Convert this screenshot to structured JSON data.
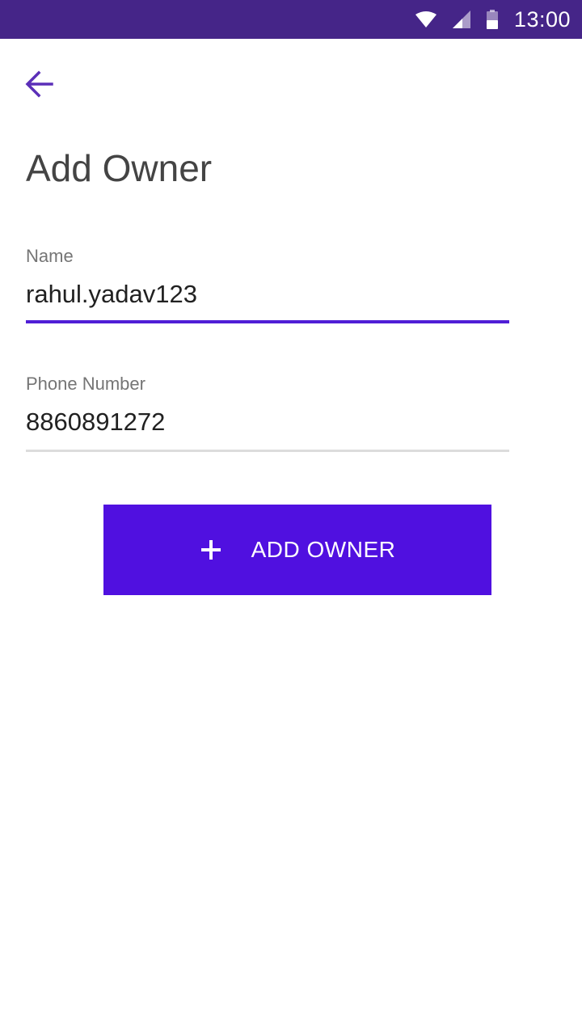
{
  "status_bar": {
    "time": "13:00",
    "bg_color": "#452588",
    "icons": [
      "wifi-icon",
      "cell-signal-icon",
      "battery-icon"
    ]
  },
  "header": {
    "back_icon": "arrow-left-icon",
    "title": "Add Owner"
  },
  "form": {
    "name_label": "Name",
    "name_value": "rahul.yadav123",
    "phone_label": "Phone Number",
    "phone_value": "8860891272"
  },
  "actions": {
    "add_owner_label": "ADD OWNER",
    "add_owner_icon": "plus-icon",
    "accent_color": "#5010e0"
  }
}
